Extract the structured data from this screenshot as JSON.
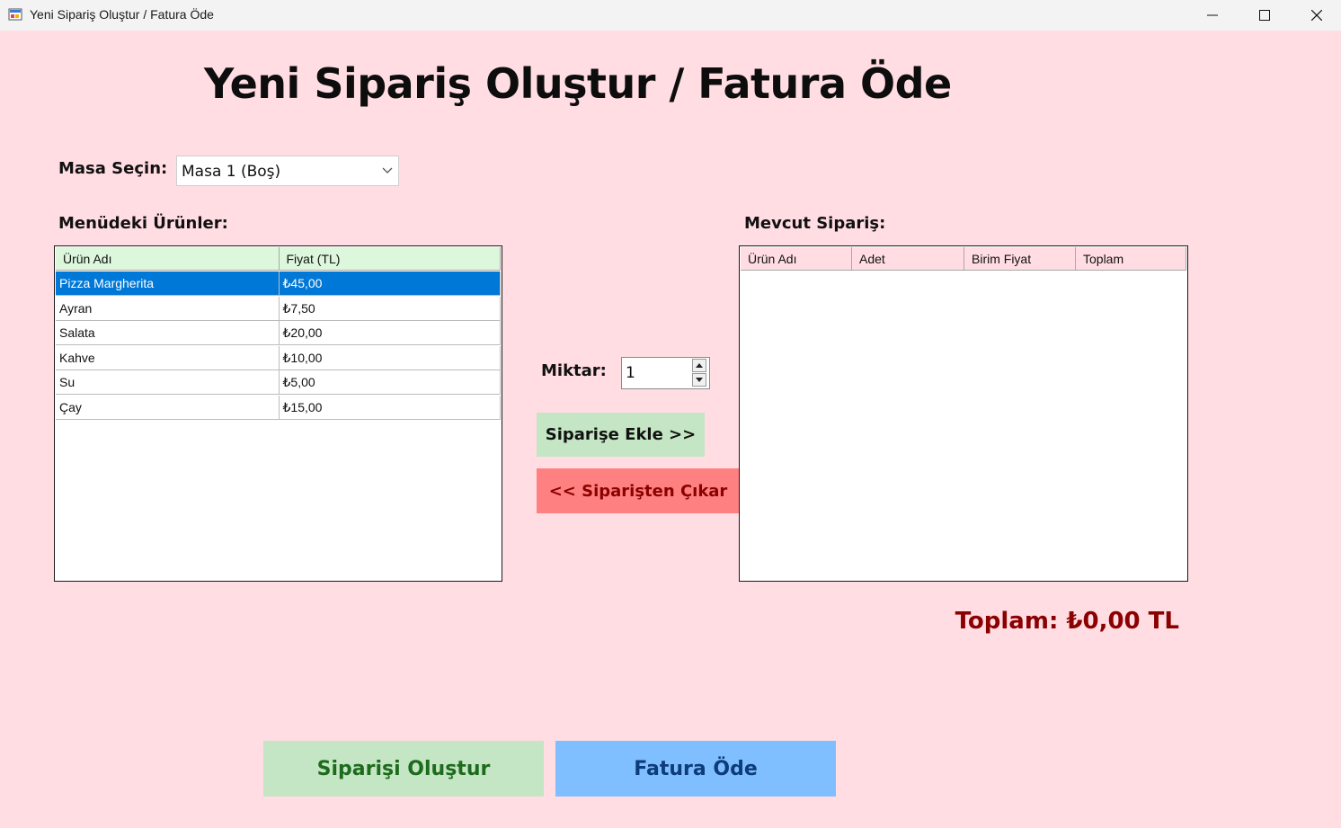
{
  "window": {
    "title": "Yeni Sipariş Oluştur / Fatura Öde"
  },
  "header": {
    "title": "Yeni Sipariş Oluştur / Fatura Öde"
  },
  "table_select": {
    "label": "Masa Seçin:",
    "value": "Masa 1 (Boş)"
  },
  "menu": {
    "label": "Menüdeki Ürünler:",
    "columns": [
      "Ürün Adı",
      "Fiyat (TL)"
    ],
    "rows": [
      {
        "name": "Pizza Margherita",
        "price": "₺45,00"
      },
      {
        "name": "Ayran",
        "price": "₺7,50"
      },
      {
        "name": "Salata",
        "price": "₺20,00"
      },
      {
        "name": "Kahve",
        "price": "₺10,00"
      },
      {
        "name": "Su",
        "price": "₺5,00"
      },
      {
        "name": "Çay",
        "price": "₺15,00"
      }
    ],
    "selected_index": 0
  },
  "quantity": {
    "label": "Miktar:",
    "value": "1"
  },
  "actions": {
    "add_label": "Siparişe Ekle >>",
    "remove_label": "<< Siparişten Çıkar"
  },
  "order": {
    "label": "Mevcut Sipariş:",
    "columns": [
      "Ürün Adı",
      "Adet",
      "Birim Fiyat",
      "Toplam"
    ],
    "rows": []
  },
  "total": {
    "text": "Toplam: ₺0,00 TL"
  },
  "footer": {
    "create_label": "Siparişi Oluştur",
    "pay_label": "Fatura Öde"
  },
  "colors": {
    "background": "#ffdde3",
    "selection": "#0078d7",
    "add_button": "#c4e6c4",
    "remove_button": "#ff8080",
    "create_button": "#c4e6c4",
    "pay_button": "#80bfff",
    "total_text": "#8b0000"
  }
}
